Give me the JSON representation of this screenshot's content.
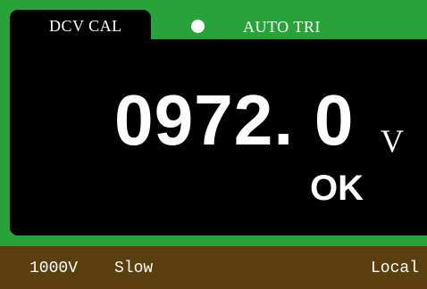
{
  "header": {
    "mode_tab": "DCV CAL",
    "status_indicator": "status-dot-icon",
    "trigger_mode": "AUTO TRI"
  },
  "display": {
    "reading": "0972. 0",
    "unit": "V",
    "result": "OK"
  },
  "statusbar": {
    "range": "1000V",
    "speed": "Slow",
    "remote": "Local"
  },
  "colors": {
    "frame_green": "#27a33a",
    "display_black": "#000000",
    "statusbar_brown": "#5c3f0e",
    "text_white": "#ffffff"
  }
}
